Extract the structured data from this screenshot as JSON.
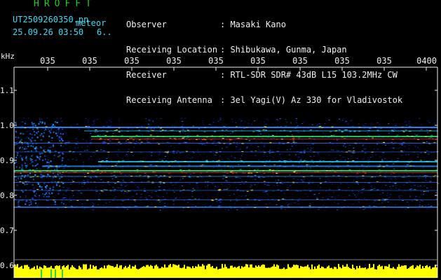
{
  "header": {
    "brand": "HROFFT",
    "filename": "UT2509260350.pn",
    "meteor_label": "meteor",
    "timestamp": "25.09.26 03:50",
    "count": "6.."
  },
  "info": [
    {
      "label": "Observer",
      "value": ": Masaki Kano"
    },
    {
      "label": "Receiving Location",
      "value": ": Shibukawa, Gunma, Japan"
    },
    {
      "label": "Receiver",
      "value": ": RTL-SDR SDR# 43dB L15 103.2MHz CW"
    },
    {
      "label": "Receiving Antenna",
      "value": ": 3el Yagi(V) Az 330 for Vladivostok"
    }
  ],
  "axis": {
    "unit": "kHz",
    "y_ticks": [
      "1.1",
      "1.0",
      "0.9",
      "0.8",
      "0.7",
      "0.6"
    ],
    "x_ticks": [
      "035",
      "035",
      "035",
      "035",
      "035",
      "035",
      "035",
      "035",
      "035",
      "0400"
    ]
  },
  "colors": {
    "header_green": "#1fd01f",
    "label_cyan": "#49d6f0",
    "axis_white": "#f0f0f0",
    "amplitude_yellow": "#ffff00",
    "background": "#000000"
  }
}
